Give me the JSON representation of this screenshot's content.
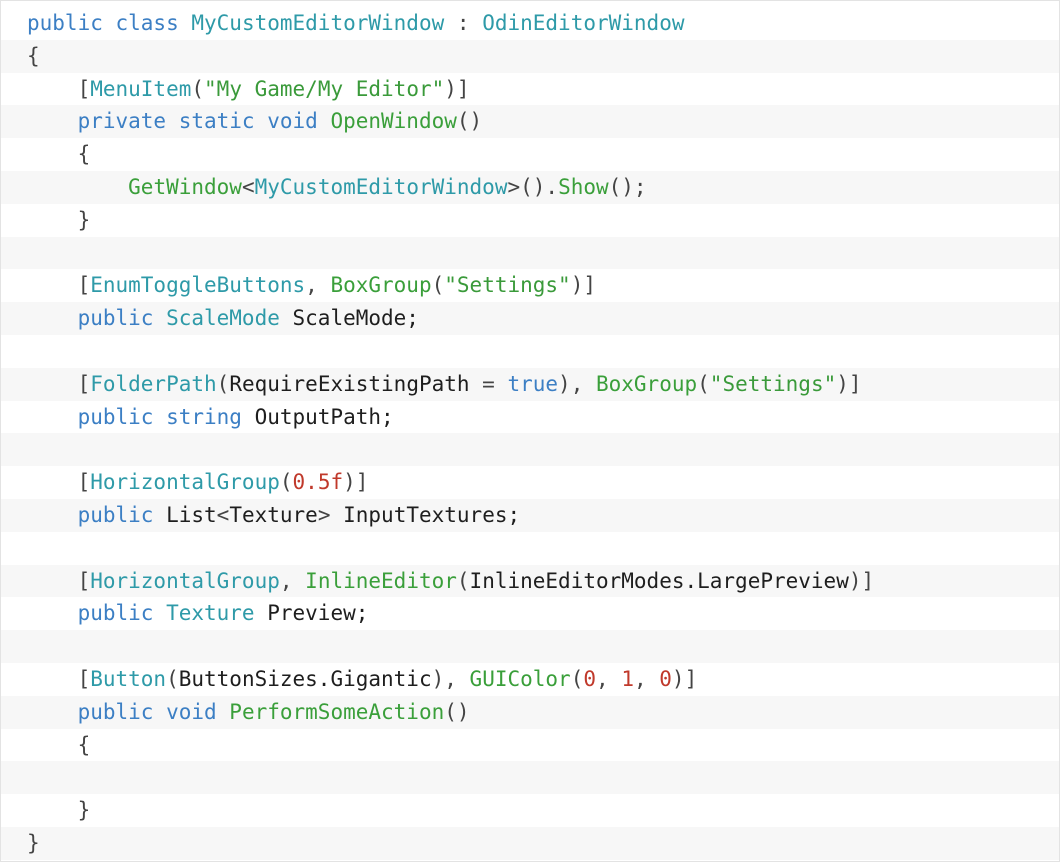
{
  "colors": {
    "keyword": "#3c7fc4",
    "type": "#2e9aa8",
    "function": "#3a9f3a",
    "string": "#3a9a3a",
    "number": "#c0392b",
    "plain": "#1e1e1e",
    "punct": "#444444",
    "stripe": "#f7f7f7",
    "border": "#e3e3e3"
  },
  "code": {
    "language": "C#",
    "lines": [
      [
        {
          "t": "public class ",
          "c": "kw"
        },
        {
          "t": "MyCustomEditorWindow",
          "c": "type"
        },
        {
          "t": " : ",
          "c": "punct"
        },
        {
          "t": "OdinEditorWindow",
          "c": "type"
        }
      ],
      [
        {
          "t": "{",
          "c": "punct"
        }
      ],
      [
        {
          "t": "    [",
          "c": "punct"
        },
        {
          "t": "MenuItem",
          "c": "type"
        },
        {
          "t": "(",
          "c": "punct"
        },
        {
          "t": "\"My Game/My Editor\"",
          "c": "str"
        },
        {
          "t": ")]",
          "c": "punct"
        }
      ],
      [
        {
          "t": "    private static void ",
          "c": "kw"
        },
        {
          "t": "OpenWindow",
          "c": "fn"
        },
        {
          "t": "()",
          "c": "punct"
        }
      ],
      [
        {
          "t": "    {",
          "c": "punct"
        }
      ],
      [
        {
          "t": "        ",
          "c": "plain"
        },
        {
          "t": "GetWindow",
          "c": "fn"
        },
        {
          "t": "<",
          "c": "punct"
        },
        {
          "t": "MyCustomEditorWindow",
          "c": "type"
        },
        {
          "t": ">().",
          "c": "punct"
        },
        {
          "t": "Show",
          "c": "fn"
        },
        {
          "t": "();",
          "c": "punct"
        }
      ],
      [
        {
          "t": "    }",
          "c": "punct"
        }
      ],
      [],
      [
        {
          "t": "    [",
          "c": "punct"
        },
        {
          "t": "EnumToggleButtons",
          "c": "type"
        },
        {
          "t": ", ",
          "c": "punct"
        },
        {
          "t": "BoxGroup",
          "c": "fn"
        },
        {
          "t": "(",
          "c": "punct"
        },
        {
          "t": "\"Settings\"",
          "c": "str"
        },
        {
          "t": ")]",
          "c": "punct"
        }
      ],
      [
        {
          "t": "    public ",
          "c": "kw"
        },
        {
          "t": "ScaleMode",
          "c": "type"
        },
        {
          "t": " ScaleMode;",
          "c": "plain"
        }
      ],
      [],
      [
        {
          "t": "    [",
          "c": "punct"
        },
        {
          "t": "FolderPath",
          "c": "type"
        },
        {
          "t": "(",
          "c": "punct"
        },
        {
          "t": "RequireExistingPath",
          "c": "plain"
        },
        {
          "t": " = ",
          "c": "punct"
        },
        {
          "t": "true",
          "c": "kw"
        },
        {
          "t": "), ",
          "c": "punct"
        },
        {
          "t": "BoxGroup",
          "c": "fn"
        },
        {
          "t": "(",
          "c": "punct"
        },
        {
          "t": "\"Settings\"",
          "c": "str"
        },
        {
          "t": ")]",
          "c": "punct"
        }
      ],
      [
        {
          "t": "    public string ",
          "c": "kw"
        },
        {
          "t": "OutputPath;",
          "c": "plain"
        }
      ],
      [],
      [
        {
          "t": "    [",
          "c": "punct"
        },
        {
          "t": "HorizontalGroup",
          "c": "type"
        },
        {
          "t": "(",
          "c": "punct"
        },
        {
          "t": "0.5f",
          "c": "num"
        },
        {
          "t": ")]",
          "c": "punct"
        }
      ],
      [
        {
          "t": "    public ",
          "c": "kw"
        },
        {
          "t": "List",
          "c": "plain"
        },
        {
          "t": "<",
          "c": "punct"
        },
        {
          "t": "Texture",
          "c": "plain"
        },
        {
          "t": ">",
          "c": "punct"
        },
        {
          "t": " InputTextures;",
          "c": "plain"
        }
      ],
      [],
      [
        {
          "t": "    [",
          "c": "punct"
        },
        {
          "t": "HorizontalGroup",
          "c": "type"
        },
        {
          "t": ", ",
          "c": "punct"
        },
        {
          "t": "InlineEditor",
          "c": "fn"
        },
        {
          "t": "(",
          "c": "punct"
        },
        {
          "t": "InlineEditorModes.LargePreview",
          "c": "plain"
        },
        {
          "t": ")]",
          "c": "punct"
        }
      ],
      [
        {
          "t": "    public ",
          "c": "kw"
        },
        {
          "t": "Texture",
          "c": "type"
        },
        {
          "t": " Preview;",
          "c": "plain"
        }
      ],
      [],
      [
        {
          "t": "    [",
          "c": "punct"
        },
        {
          "t": "Button",
          "c": "type"
        },
        {
          "t": "(",
          "c": "punct"
        },
        {
          "t": "ButtonSizes.Gigantic",
          "c": "plain"
        },
        {
          "t": "), ",
          "c": "punct"
        },
        {
          "t": "GUIColor",
          "c": "fn"
        },
        {
          "t": "(",
          "c": "punct"
        },
        {
          "t": "0",
          "c": "num"
        },
        {
          "t": ", ",
          "c": "punct"
        },
        {
          "t": "1",
          "c": "num"
        },
        {
          "t": ", ",
          "c": "punct"
        },
        {
          "t": "0",
          "c": "num"
        },
        {
          "t": ")]",
          "c": "punct"
        }
      ],
      [
        {
          "t": "    public void ",
          "c": "kw"
        },
        {
          "t": "PerformSomeAction",
          "c": "fn"
        },
        {
          "t": "()",
          "c": "punct"
        }
      ],
      [
        {
          "t": "    {",
          "c": "punct"
        }
      ],
      [],
      [
        {
          "t": "    }",
          "c": "punct"
        }
      ],
      [
        {
          "t": "}",
          "c": "punct"
        }
      ]
    ]
  }
}
